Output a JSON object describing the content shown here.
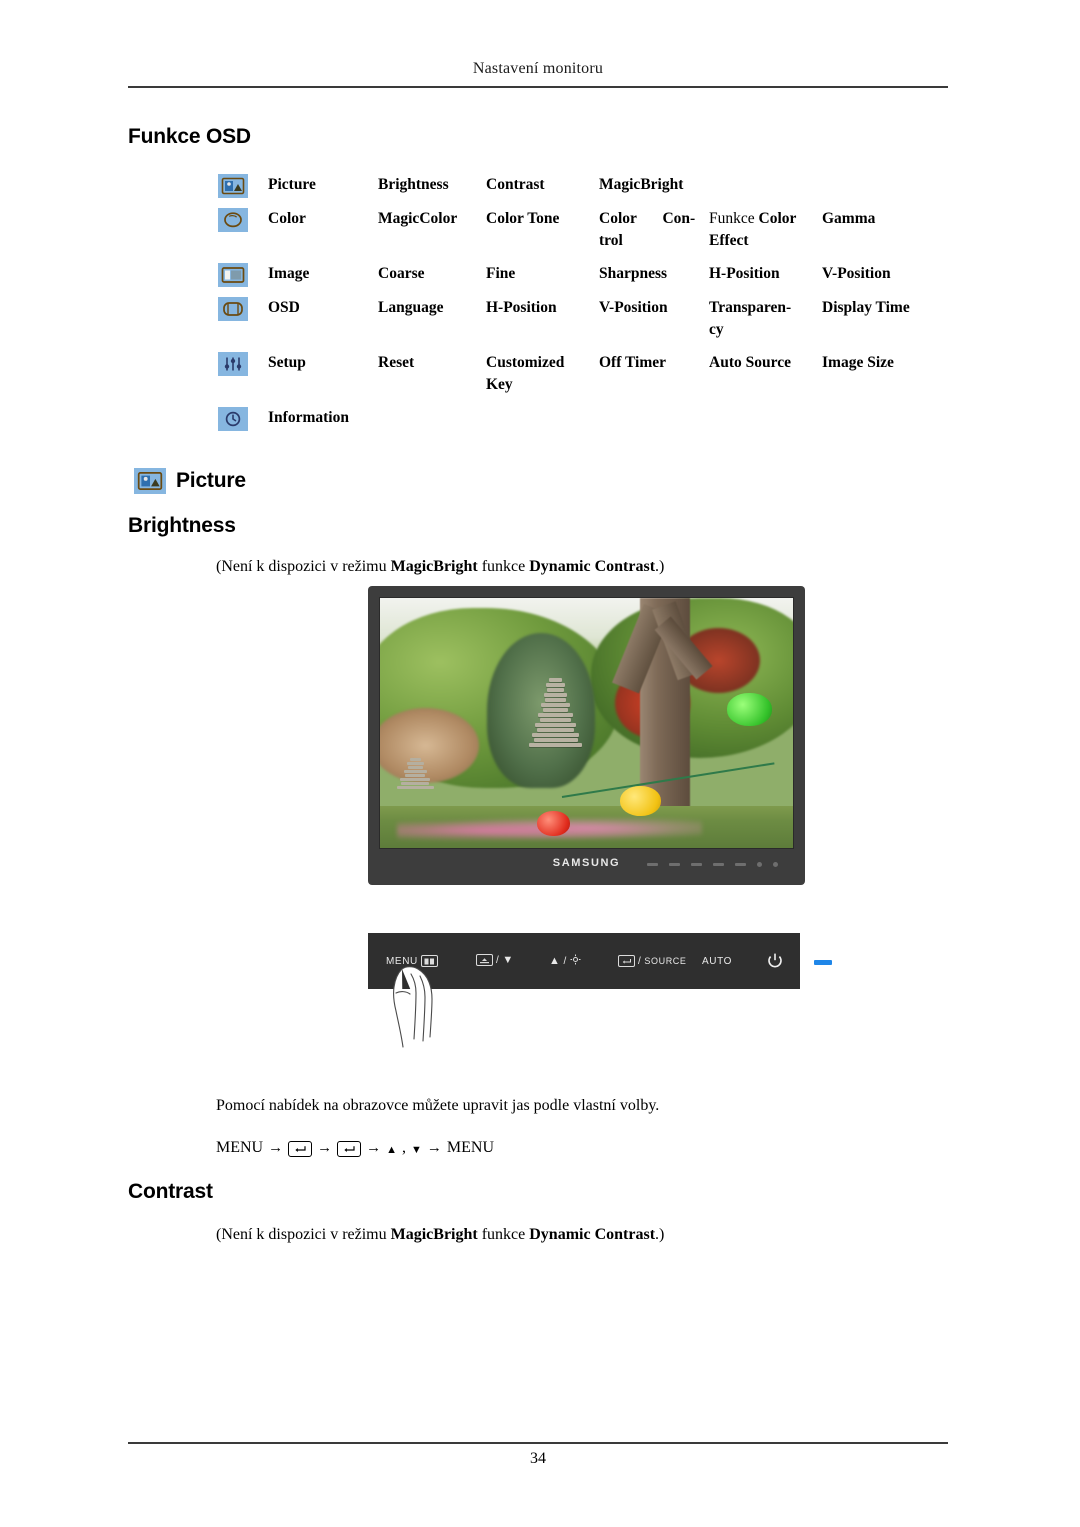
{
  "header": {
    "title": "Nastavení monitoru"
  },
  "sections": {
    "funkce_osd_title": "Funkce OSD",
    "picture_title": "Picture",
    "brightness_title": "Brightness",
    "contrast_title": "Contrast"
  },
  "osd_table": {
    "rows": [
      {
        "icon": "picture-icon",
        "group": "Picture",
        "items": [
          "Brightness",
          "Contrast",
          "MagicBright",
          "",
          ""
        ]
      },
      {
        "icon": "color-icon",
        "group": "Color",
        "items": [
          "MagicColor",
          "Color Tone",
          "Color Control",
          "Funkce Color Effect",
          "Gamma"
        ],
        "item3_a": "Color",
        "item3_b": "Con-",
        "item3_c": "trol",
        "item4_regular": "Funkce",
        "item4_bold": "Color",
        "item4_bold2": "Effect"
      },
      {
        "icon": "image-icon",
        "group": "Image",
        "items": [
          "Coarse",
          "Fine",
          "Sharpness",
          "H-Position",
          "V-Position"
        ]
      },
      {
        "icon": "osd-icon",
        "group": "OSD",
        "items": [
          "Language",
          "H-Position",
          "V-Position",
          "Transparency",
          "Display Time"
        ],
        "item4_a": "Transparen-",
        "item4_b": "cy"
      },
      {
        "icon": "setup-icon",
        "group": "Setup",
        "items": [
          "Reset",
          "Customized Key",
          "Off Timer",
          "Auto Source",
          "Image Size"
        ],
        "item2_a": "Customized",
        "item2_b": "Key"
      },
      {
        "icon": "information-icon",
        "group": "Information",
        "items": [
          "",
          "",
          "",
          "",
          ""
        ]
      }
    ]
  },
  "brightness": {
    "note_prefix": "(Není k dispozici v režimu ",
    "note_bold1": "MagicBright",
    "note_mid": " funkce ",
    "note_bold2": "Dynamic Contrast",
    "note_suffix": ".)",
    "description": "Pomocí nabídek na obrazovce můžete upravit jas podle vlastní volby.",
    "menu_sequence": {
      "start": "MENU",
      "arrow": "→",
      "enter_key": "enter-key-icon",
      "up_triangle": "▲",
      "comma": ",",
      "down_triangle": "▼",
      "end": "MENU"
    }
  },
  "contrast": {
    "note_prefix": "(Není k dispozici v režimu ",
    "note_bold1": "MagicBright",
    "note_mid": " funkce ",
    "note_bold2": "Dynamic Contrast",
    "note_suffix": ".)"
  },
  "monitor_illustration": {
    "brand": "SAMSUNG",
    "alt": "Samsung monitor displaying a garden photo with stone pagodas, trees and paper lanterns"
  },
  "control_bar": {
    "menu_label": "MENU",
    "down_label": "▼",
    "up_label": "▲",
    "source_label": "SOURCE",
    "auto_label": "AUTO",
    "power_label": "power-icon",
    "led_color": "#1f86e8",
    "separator": "/"
  },
  "footer": {
    "page_number": "34"
  },
  "colors": {
    "icon_fill": "#f0a32a",
    "icon_border": "#86b6e0",
    "bezel": "#3d3d3d",
    "control_bar_bg": "#2f2f2f",
    "rule": "#3a3a3a"
  }
}
